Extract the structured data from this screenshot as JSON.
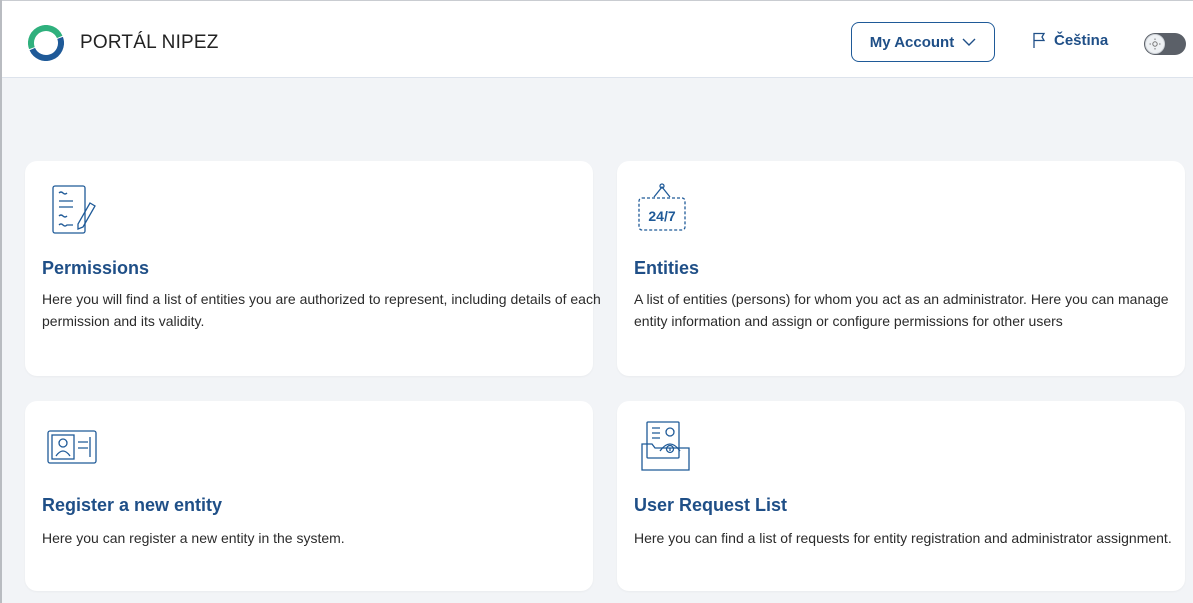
{
  "header": {
    "brand": "PORTÁL NIPEZ",
    "account_label": "My Account",
    "language_label": "Čeština"
  },
  "cards": [
    {
      "title": "Permissions",
      "description": "Here you will find a list of entities you are authorized to represent, including details of each permission and its validity.",
      "icon": "document-edit-icon"
    },
    {
      "title": "Entities",
      "description": "A list of entities (persons) for whom you act as an administrator. Here you can manage entity information and assign or configure permissions for other users",
      "icon": "sign-24-7-icon",
      "icon_text": "24/7"
    },
    {
      "title": "Register a new entity",
      "description": "Here you can register a new entity in the system.",
      "icon": "id-card-icon"
    },
    {
      "title": "User Request List",
      "description": "Here you can find a list of requests for entity registration and administrator assignment.",
      "icon": "folder-user-icon"
    }
  ],
  "colors": {
    "accent": "#1f4f87",
    "background": "#f2f4f7",
    "card": "#ffffff",
    "logo_green": "#2fb07d",
    "logo_blue": "#1f5a98"
  }
}
